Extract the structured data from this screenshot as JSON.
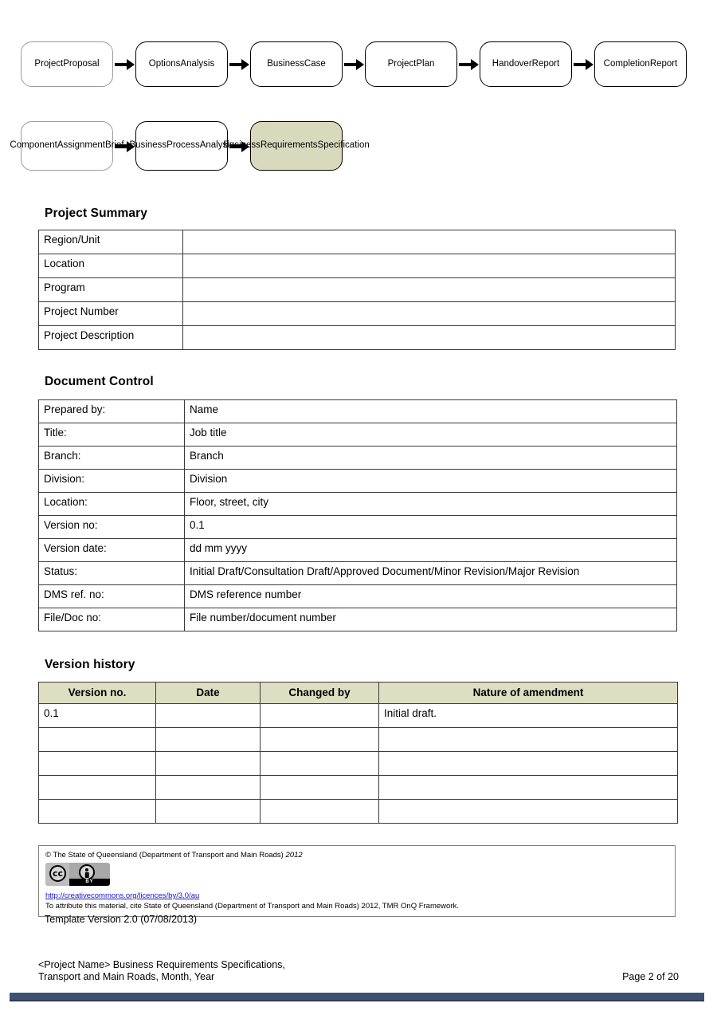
{
  "flow_diagram": {
    "row1": [
      {
        "label": "Project\nProposal",
        "style": "first"
      },
      {
        "label": "Options\nAnalysis",
        "style": "normal"
      },
      {
        "label": "Business\nCase",
        "style": "normal"
      },
      {
        "label": "Project\nPlan",
        "style": "normal"
      },
      {
        "label": "Handover\nReport",
        "style": "normal"
      },
      {
        "label": "Completion\nReport",
        "style": "normal"
      }
    ],
    "row2": [
      {
        "label": "Component\nAssignment\nBrief",
        "style": "first"
      },
      {
        "label": "Business\nProcess\nAnalysis",
        "style": "normal"
      },
      {
        "label": "Business\nRequirements\nSpecification",
        "style": "highlight"
      }
    ],
    "highlight_color": "#d9d9bd",
    "arrow_icon": "right-arrow-icon"
  },
  "project_summary": {
    "heading": "Project Summary",
    "rows": [
      {
        "label": "Region/Unit",
        "value": ""
      },
      {
        "label": "Location",
        "value": ""
      },
      {
        "label": "Program",
        "value": ""
      },
      {
        "label": "Project Number",
        "value": ""
      },
      {
        "label": "Project Description",
        "value": ""
      }
    ]
  },
  "document_control": {
    "heading": "Document Control",
    "rows": [
      {
        "label": "Prepared by:",
        "value": "Name"
      },
      {
        "label": "Title:",
        "value": "Job title"
      },
      {
        "label": "Branch:",
        "value": "Branch"
      },
      {
        "label": "Division:",
        "value": "Division"
      },
      {
        "label": "Location:",
        "value": "Floor, street, city"
      },
      {
        "label": "Version no:",
        "value": "0.1"
      },
      {
        "label": "Version date:",
        "value": "dd mm yyyy"
      },
      {
        "label": "Status:",
        "value": "Initial Draft/Consultation Draft/Approved Document/Minor Revision/Major Revision"
      },
      {
        "label": "DMS ref. no:",
        "value": "DMS reference number"
      },
      {
        "label": "File/Doc no:",
        "value": "File number/document number"
      }
    ]
  },
  "version_history": {
    "heading": "Version history",
    "columns": [
      "Version no.",
      "Date",
      "Changed by",
      "Nature of amendment"
    ],
    "rows": [
      [
        "0.1",
        "",
        "",
        "Initial draft."
      ],
      [
        "",
        "",
        "",
        ""
      ],
      [
        "",
        "",
        "",
        ""
      ],
      [
        "",
        "",
        "",
        ""
      ],
      [
        "",
        "",
        "",
        ""
      ]
    ]
  },
  "copyright": {
    "line1": "© The State of Queensland (Department of Transport and Main Roads) ",
    "line1_year": "2012",
    "licence_url": "http://creativecommons.org/licences/by/3.0/au",
    "attribution": "To attribute this material, cite State of Queensland (Department of Transport and Main Roads) 2012, TMR OnQ Framework.",
    "badge_cc": "cc",
    "badge_by": "BY"
  },
  "template_version": "Template Version 2.0 (07/08/2013)",
  "footer": {
    "line1": "<Project Name> Business Requirements Specifications,",
    "line2": "Transport and Main Roads, Month, Year",
    "page_number": "Page 2 of 20",
    "bar_color": "#3f5172"
  },
  "table_header_color": "#dedec2"
}
